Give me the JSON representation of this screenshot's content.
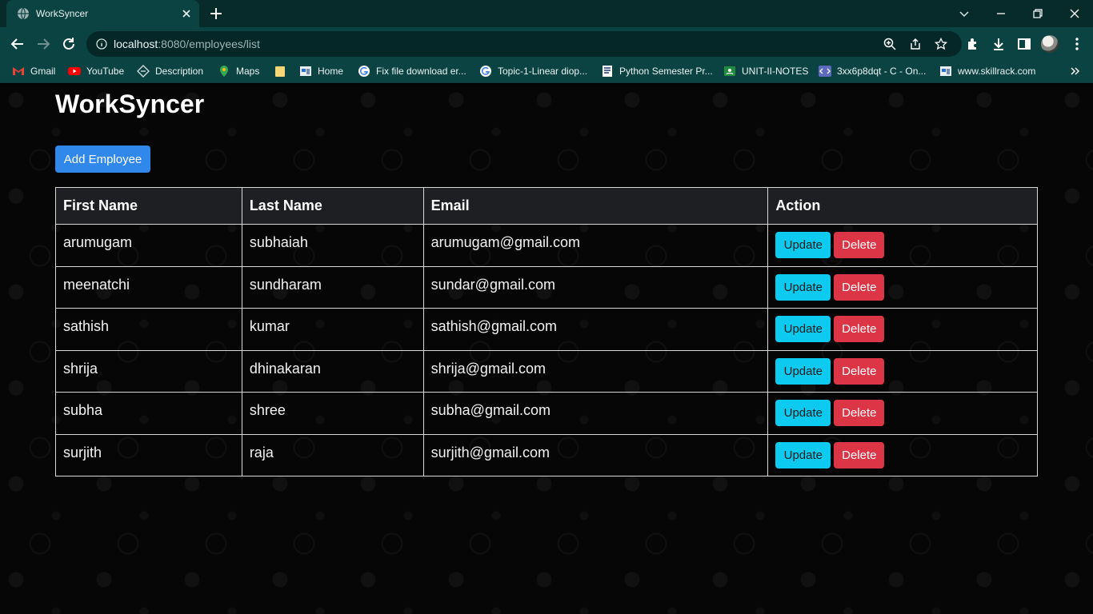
{
  "browser": {
    "tab_title": "WorkSyncer",
    "url_host": "localhost",
    "url_rest": ":8080/employees/list",
    "bookmarks": [
      {
        "label": "Gmail",
        "icon": "gmail-icon"
      },
      {
        "label": "YouTube",
        "icon": "youtube-icon"
      },
      {
        "label": "Description",
        "icon": "description-icon"
      },
      {
        "label": "Maps",
        "icon": "maps-icon"
      },
      {
        "label": "",
        "icon": "folder-icon"
      },
      {
        "label": "Home",
        "icon": "home-icon"
      },
      {
        "label": "Fix file download er...",
        "icon": "google-icon"
      },
      {
        "label": "Topic-1-Linear diop...",
        "icon": "google-icon"
      },
      {
        "label": "Python Semester Pr...",
        "icon": "document-icon"
      },
      {
        "label": "UNIT-II-NOTES",
        "icon": "classroom-icon"
      },
      {
        "label": "3xx6p8dqt - C - On...",
        "icon": "code-icon"
      },
      {
        "label": "www.skillrack.com",
        "icon": "skillrack-icon"
      }
    ]
  },
  "page": {
    "title": "WorkSyncer",
    "add_button": "Add Employee",
    "columns": [
      "First Name",
      "Last Name",
      "Email",
      "Action"
    ],
    "update_label": "Update",
    "delete_label": "Delete",
    "rows": [
      {
        "first": "arumugam",
        "last": "subhaiah",
        "email": "arumugam@gmail.com"
      },
      {
        "first": "meenatchi",
        "last": "sundharam",
        "email": "sundar@gmail.com"
      },
      {
        "first": "sathish",
        "last": "kumar",
        "email": "sathish@gmail.com"
      },
      {
        "first": "shrija",
        "last": "dhinakaran",
        "email": "shrija@gmail.com"
      },
      {
        "first": "subha",
        "last": "shree",
        "email": "subha@gmail.com"
      },
      {
        "first": "surjith",
        "last": "raja",
        "email": "surjith@gmail.com"
      }
    ]
  },
  "colors": {
    "chrome_frame": "#072b2b",
    "chrome_toolbar": "#0b4343",
    "primary_button": "#2f88ea",
    "update_button": "#0dcaf0",
    "delete_button": "#dc3545"
  }
}
